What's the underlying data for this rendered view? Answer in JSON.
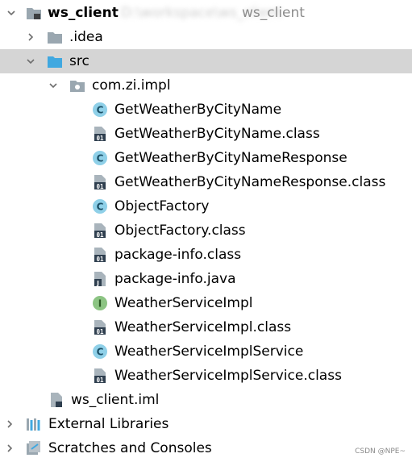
{
  "root": {
    "name": "ws_client",
    "path_blurred": "D:\\workspace\\ws_client",
    "path_visible": "ws_client"
  },
  "tree": {
    "idea": ".idea",
    "src": "src",
    "package": "com.zi.impl",
    "files": [
      {
        "name": "GetWeatherByCityName",
        "kind": "class"
      },
      {
        "name": "GetWeatherByCityName.class",
        "kind": "binary"
      },
      {
        "name": "GetWeatherByCityNameResponse",
        "kind": "class"
      },
      {
        "name": "GetWeatherByCityNameResponse.class",
        "kind": "binary"
      },
      {
        "name": "ObjectFactory",
        "kind": "class"
      },
      {
        "name": "ObjectFactory.class",
        "kind": "binary"
      },
      {
        "name": "package-info.class",
        "kind": "binary"
      },
      {
        "name": "package-info.java",
        "kind": "java"
      },
      {
        "name": "WeatherServiceImpl",
        "kind": "interface"
      },
      {
        "name": "WeatherServiceImpl.class",
        "kind": "binary"
      },
      {
        "name": "WeatherServiceImplService",
        "kind": "class"
      },
      {
        "name": "WeatherServiceImplService.class",
        "kind": "binary"
      }
    ],
    "iml": "ws_client.iml",
    "external_libraries": "External Libraries",
    "scratches": "Scratches and Consoles"
  },
  "icons": {
    "class_letter": "C",
    "interface_letter": "I",
    "binary_text": "01",
    "java_letter": "J"
  },
  "colors": {
    "selection": "#d5d5d5",
    "class_icon": "#8fd0e8",
    "interface_icon": "#8cc483",
    "folder": "#9aa7b0",
    "src_folder": "#40a8e0"
  },
  "watermark": "CSDN @NPE~"
}
